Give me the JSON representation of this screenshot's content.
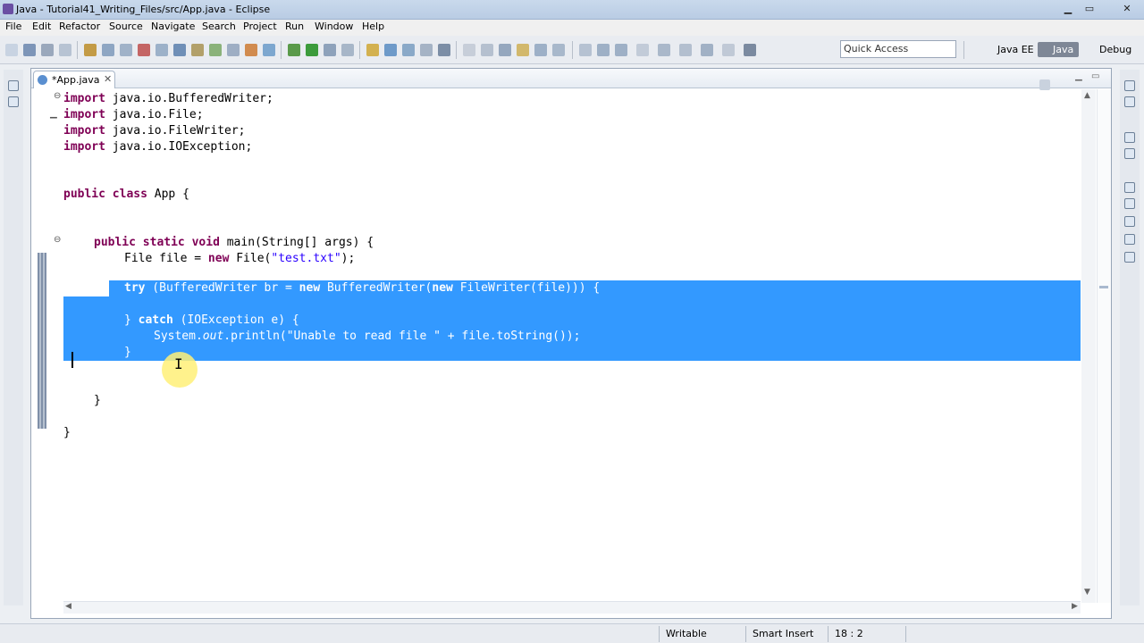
{
  "window": {
    "title": "Java - Tutorial41_Writing_Files/src/App.java - Eclipse"
  },
  "menu": [
    "File",
    "Edit",
    "Refactor",
    "Source",
    "Navigate",
    "Search",
    "Project",
    "Run",
    "Window",
    "Help"
  ],
  "toolbar": {
    "quick_access_placeholder": "Quick Access",
    "perspectives": {
      "java_ee": "Java EE",
      "java": "Java",
      "debug": "Debug"
    }
  },
  "editor": {
    "tab_label": "*App.java",
    "close_glyph": "✕",
    "code": {
      "l1": {
        "kw": "import",
        "rest": " java.io.BufferedWriter;"
      },
      "l2": {
        "kw": "import",
        "rest": " java.io.File;"
      },
      "l3": {
        "kw": "import",
        "rest": " java.io.FileWriter;"
      },
      "l4": {
        "kw": "import",
        "rest": " java.io.IOException;"
      },
      "l6": {
        "kw1": "public",
        "kw2": "class",
        "rest": " App {"
      },
      "l8": {
        "kw1": "public",
        "kw2": "static",
        "kw3": "void",
        "rest": " main(String[] args) {"
      },
      "l9": {
        "a": "File file = ",
        "kw": "new",
        "b": " File(",
        "str": "\"test.txt\"",
        "c": ");"
      },
      "l11": {
        "kw1": "try",
        "a": " (BufferedWriter br = ",
        "kw2": "new",
        "b": " BufferedWriter(",
        "kw3": "new",
        "c": " FileWriter(file))) {"
      },
      "l13": {
        "a": "} ",
        "kw": "catch",
        "b": " (IOException e) {"
      },
      "l14": {
        "a": "System.",
        "it": "out",
        "b": ".println(",
        "str": "\"Unable to read file \"",
        "c": " + file.toString());"
      },
      "l15": {
        "a": "}"
      },
      "l17": {
        "a": "}"
      },
      "l19": {
        "a": "}"
      }
    }
  },
  "status": {
    "writable": "Writable",
    "insert_mode": "Smart Insert",
    "position": "18 : 2"
  }
}
